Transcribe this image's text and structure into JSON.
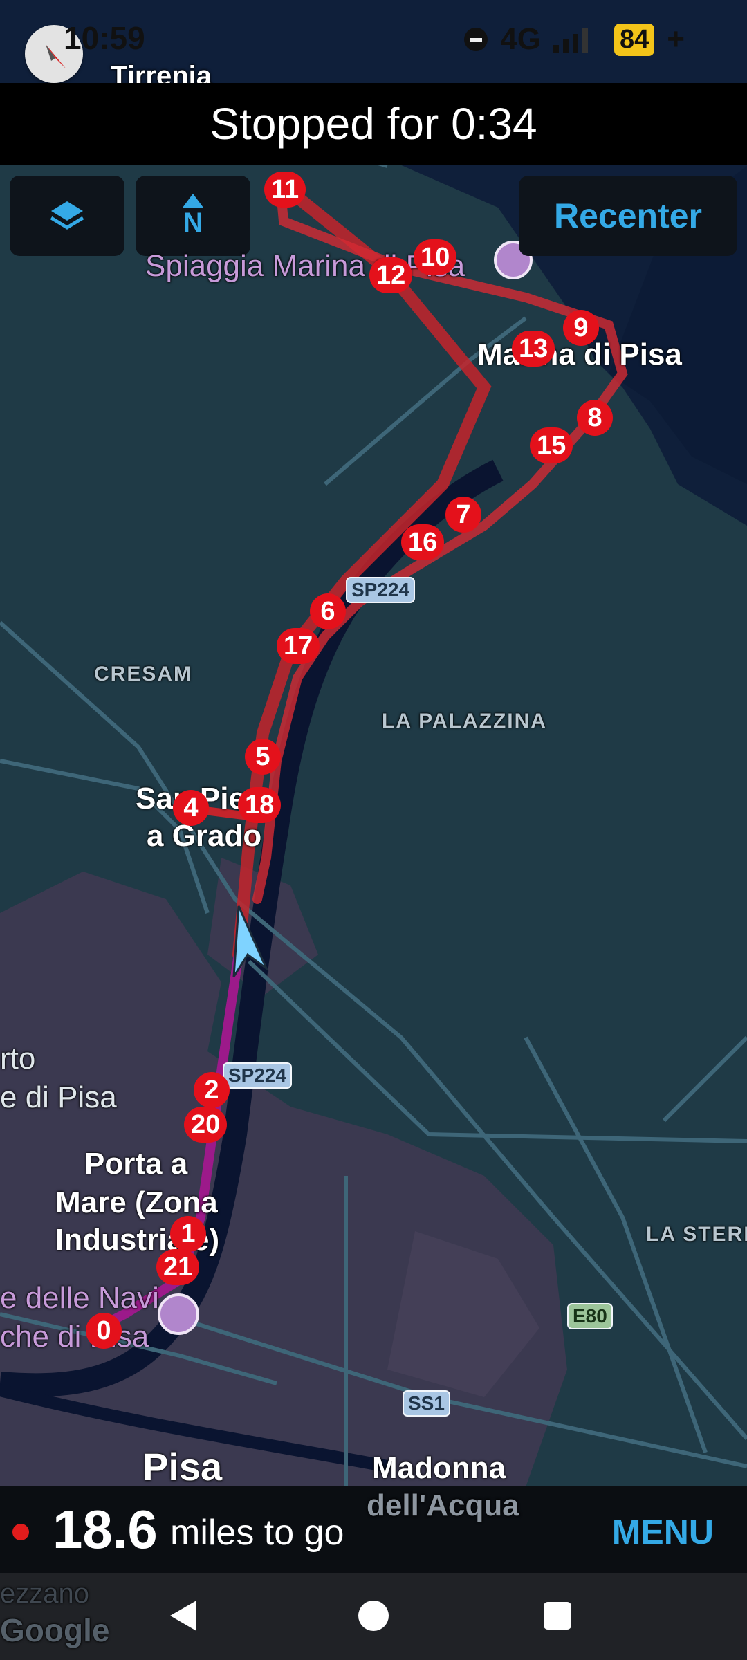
{
  "status_bar": {
    "time": "10:59",
    "network": "4G",
    "battery": "84",
    "battery_plus": "+"
  },
  "banner": {
    "text": "Stopped for 0:34"
  },
  "controls": {
    "layers_icon": "layers-icon",
    "north_icon": "north-up-icon",
    "north_label": "N",
    "recenter_label": "Recenter"
  },
  "map": {
    "places": {
      "tirrenia": "Tirrenia",
      "spiaggia": "Spiaggia Marina di Pisa",
      "marina": "Marina di Pisa",
      "cresam": "CRESAM",
      "palazzina": "LA PALAZZINA",
      "san_piero_1": "San Piero",
      "san_piero_2": "a Grado",
      "porto_1": "rto",
      "porto_2": "e di Pisa",
      "porta_1": "Porta a",
      "porta_2": "Mare (Zona",
      "porta_3": "Industriale)",
      "navi_1": "e delle Navi",
      "navi_2": "che di Pisa",
      "sterpaia": "LA STERP",
      "pisa": "Pisa",
      "madonna_1": "Madonna",
      "madonna_2": "dell'Acqua",
      "ezzano": "ezzano"
    },
    "roads": {
      "sp224_a": "SP224",
      "sp224_b": "SP224",
      "e80": "E80",
      "ss1": "SS1"
    },
    "watermark": "Google",
    "markers": [
      "0",
      "1",
      "2",
      "4",
      "5",
      "6",
      "7",
      "8",
      "9",
      "10",
      "11",
      "12",
      "13",
      "15",
      "16",
      "17",
      "18",
      "20",
      "21"
    ]
  },
  "bottom": {
    "distance": "18.6",
    "distance_text": "miles to go",
    "menu_label": "MENU"
  },
  "colors": {
    "accent": "#34a9e6",
    "marker": "#e4111b",
    "route": "#c4242b",
    "route_active": "#9c1a8a"
  }
}
